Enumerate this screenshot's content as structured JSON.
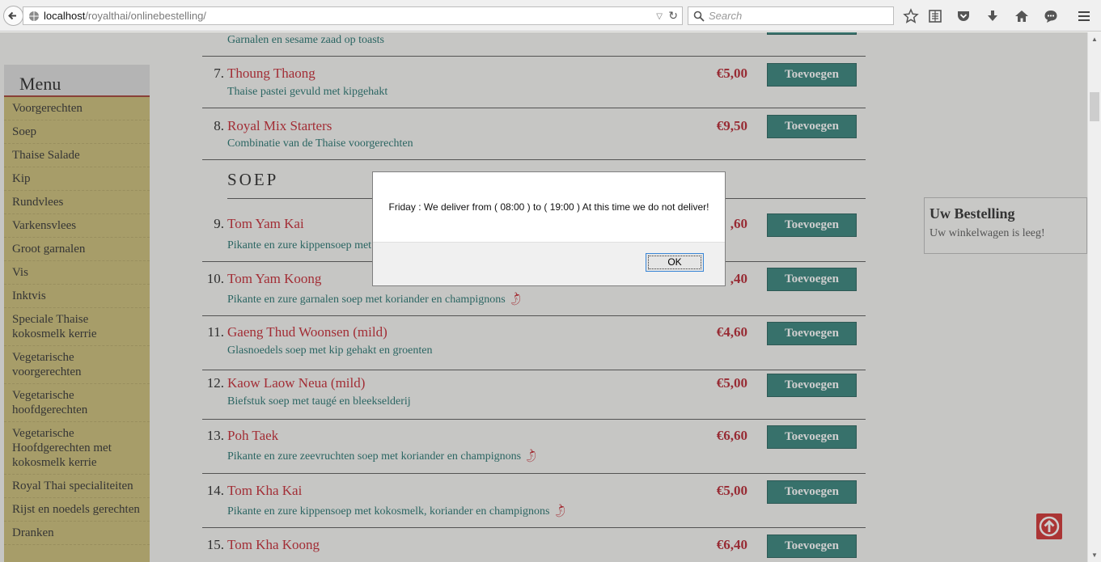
{
  "browser": {
    "url_host": "localhost",
    "url_path": "/royalthai/onlinebestelling/",
    "search_placeholder": "Search"
  },
  "sidebar": {
    "title": "Menu",
    "items": [
      "Voorgerechten",
      "Soep",
      "Thaise Salade",
      "Kip",
      "Rundvlees",
      "Varkensvlees",
      "Groot garnalen",
      "Vis",
      "Inktvis",
      "Speciale Thaise kokosmelk kerrie",
      "Vegetarische voorgerechten",
      "Vegetarische hoofdgerechten",
      "Vegetarische Hoofdgerechten met kokosmelk kerrie",
      "Royal Thai specialiteiten",
      "Rijst en noedels gerechten",
      "Dranken"
    ]
  },
  "menu": {
    "add_label": "Toevoegen",
    "section_title": "SOEP",
    "partial_top_desc": "Garnalen en sesame zaad op toasts",
    "items": [
      {
        "num": "7.",
        "name": "Thoung Thaong",
        "desc": "Thaise pastei gevuld met kipgehakt",
        "price": "€5,00",
        "spicy": false
      },
      {
        "num": "8.",
        "name": "Royal Mix Starters",
        "desc": "Combinatie van de Thaise voorgerechten",
        "price": "€9,50",
        "spicy": false
      },
      {
        "num": "9.",
        "name": "Tom Yam Kai",
        "desc": "Pikante en zure kippensoep met",
        "price": ",60",
        "spicy": false
      },
      {
        "num": "10.",
        "name": "Tom Yam Koong",
        "desc": "Pikante en zure garnalen soep met koriander en champignons",
        "price": ",40",
        "spicy": true
      },
      {
        "num": "11.",
        "name": "Gaeng Thud Woonsen (mild)",
        "desc": "Glasnoedels soep met kip gehakt en groenten",
        "price": "€4,60",
        "spicy": false
      },
      {
        "num": "12.",
        "name": "Kaow Laow Neua (mild)",
        "desc": "Biefstuk soep met taugé en bleekselderij",
        "price": "€5,00",
        "spicy": false
      },
      {
        "num": "13.",
        "name": "Poh Taek",
        "desc": "Pikante en zure zeevruchten soep met koriander en champignons",
        "price": "€6,60",
        "spicy": true
      },
      {
        "num": "14.",
        "name": "Tom Kha Kai",
        "desc": "Pikante en zure kippensoep met kokosmelk, koriander en champignons",
        "price": "€5,00",
        "spicy": true
      },
      {
        "num": "15.",
        "name": "Tom Kha Koong",
        "desc": "",
        "price": "€6,40",
        "spicy": true
      }
    ]
  },
  "cart": {
    "title": "Uw Bestelling",
    "empty_text": "Uw winkelwagen is leeg!"
  },
  "dialog": {
    "message": "Friday : We deliver from ( 08:00 ) to ( 19:00 ) At this time we do not deliver!",
    "ok_label": "OK"
  },
  "icons": [
    "back-arrow-icon",
    "globe-icon",
    "dropdown-icon",
    "reload-icon",
    "search-icon",
    "bookmark-star-icon",
    "reading-list-icon",
    "pocket-icon",
    "download-icon",
    "home-icon",
    "chat-icon",
    "hamburger-menu-icon",
    "chili-icon",
    "arrow-up-icon"
  ],
  "colors": {
    "accent_red": "#c3202c",
    "button_teal": "#2f7e76",
    "desc_teal": "#1d6e6a",
    "sidebar_bg": "#c9bb73"
  }
}
